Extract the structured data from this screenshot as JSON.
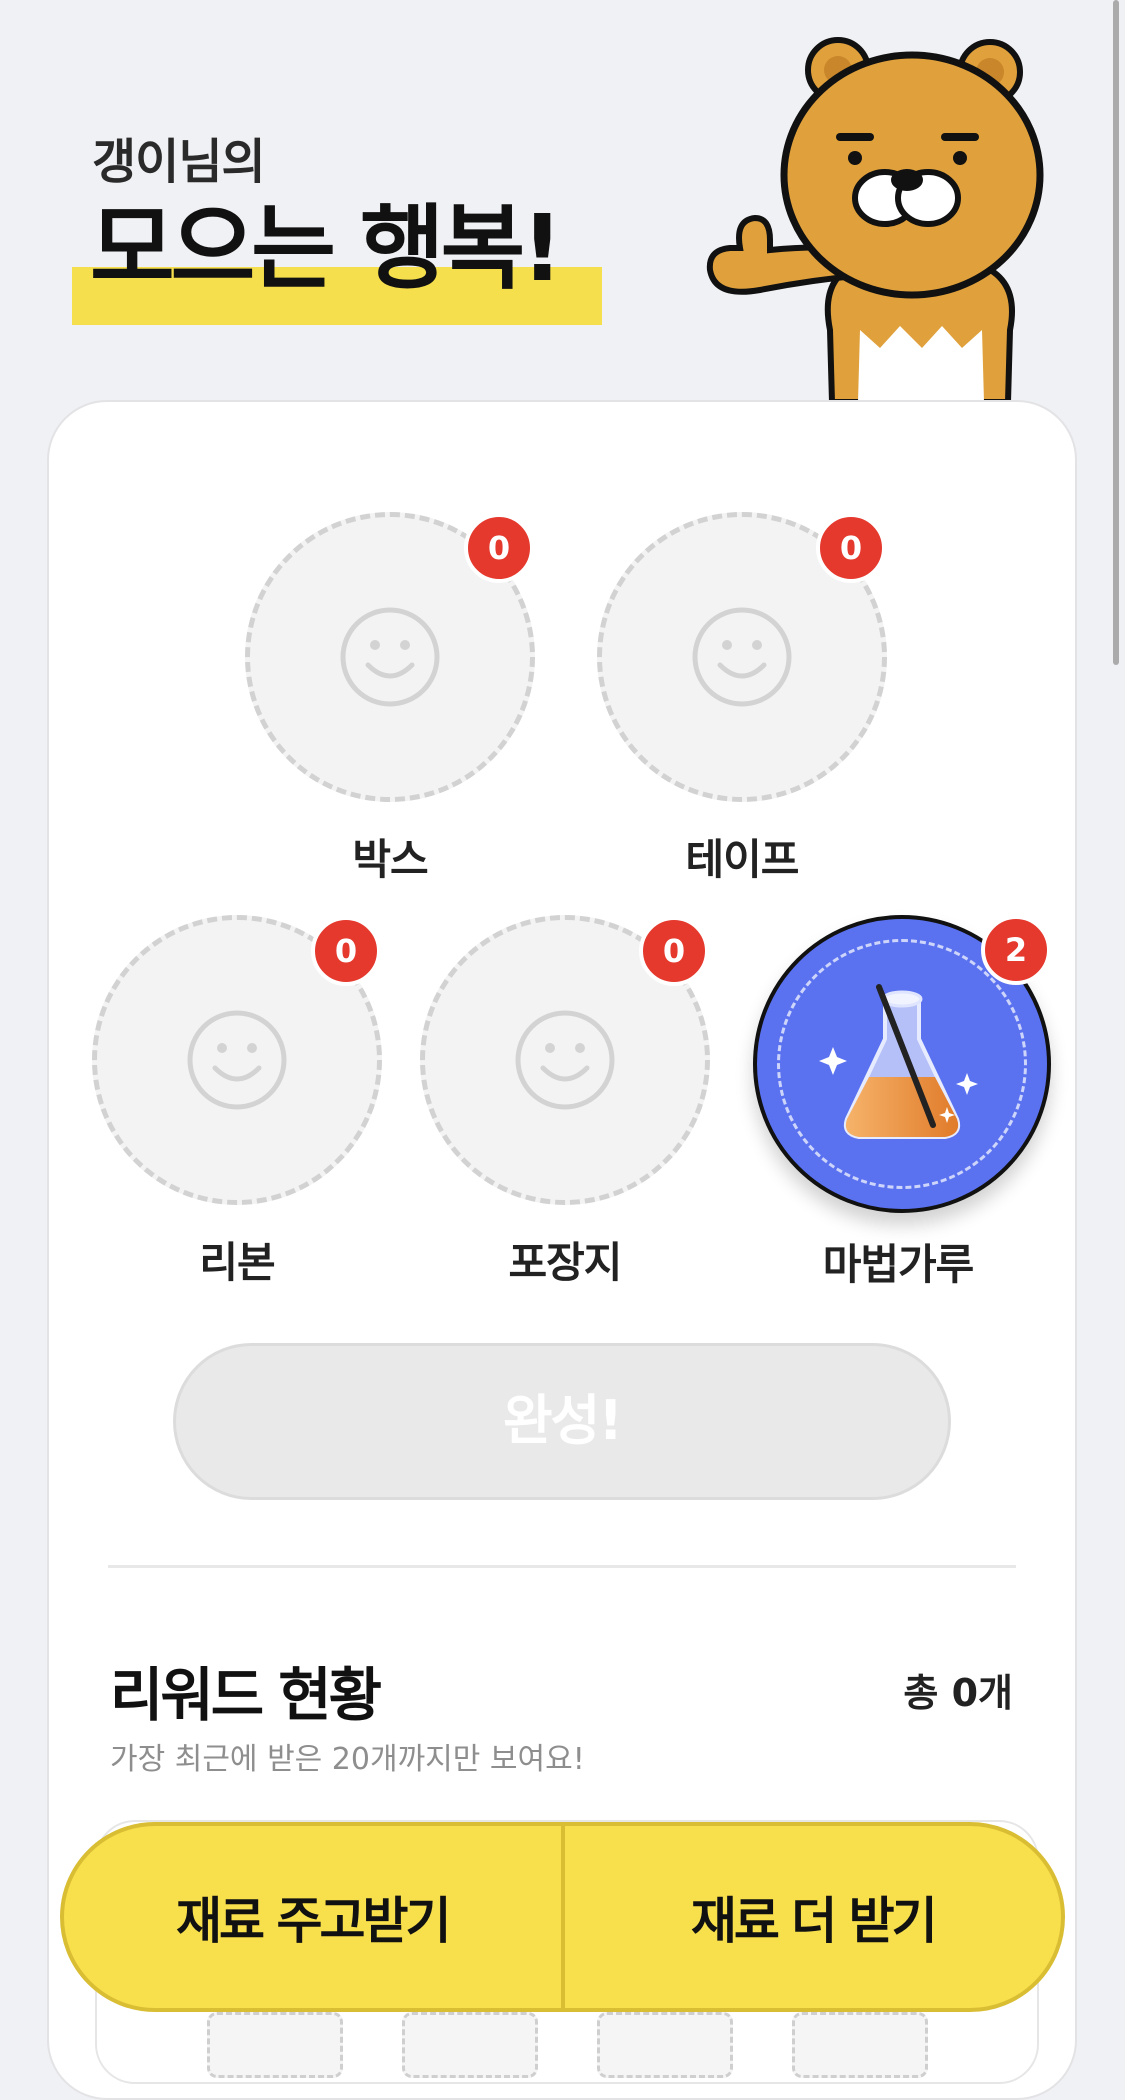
{
  "header": {
    "greeting": "갱이님의",
    "headline": "모으는 행복!"
  },
  "materials": [
    {
      "label": "박스",
      "count": "0",
      "collected": false
    },
    {
      "label": "테이프",
      "count": "0",
      "collected": false
    },
    {
      "label": "리본",
      "count": "0",
      "collected": false
    },
    {
      "label": "포장지",
      "count": "0",
      "collected": false
    },
    {
      "label": "마법가루",
      "count": "2",
      "collected": true,
      "icon": "potion-flask-icon"
    }
  ],
  "complete_button": {
    "label": "완성!",
    "enabled": false
  },
  "rewards": {
    "title": "리워드 현황",
    "total": "총 0개",
    "subtitle": "가장 최근에 받은 20개까지만 보여요!"
  },
  "bottom_actions": {
    "exchange_label": "재료 주고받기",
    "get_more_label": "재료 더 받기"
  },
  "colors": {
    "accent_yellow": "#f8df4c",
    "badge_red": "#e5392e",
    "active_blue": "#5b72f0"
  }
}
